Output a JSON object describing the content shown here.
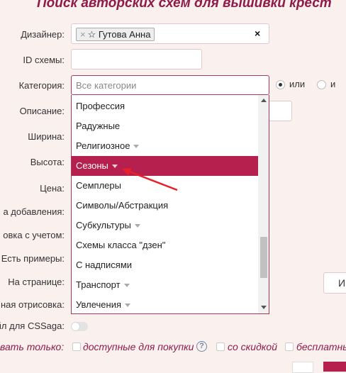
{
  "page_title": "Поиск авторских схем для вышивки крест",
  "labels": {
    "designer": "Дизайнер:",
    "scheme_id": "ID схемы:",
    "category": "Категория:",
    "description": "Описание:",
    "width": "Ширина:",
    "height": "Высота:",
    "price": "Цена:",
    "date_added": "а добавления:",
    "sort": "овка с учетом:",
    "examples": "Есть примеры:",
    "per_page": "На странице:",
    "drawing": "ная отрисовка:",
    "cssaga": "йл для CSSaga:",
    "show_only": "вать только:"
  },
  "designer_tag": "☆ Гутова Анна",
  "tag_remove": "×",
  "clear_icon": "×",
  "category_placeholder": "Все категории",
  "radio_or": "или",
  "radio_and": "и",
  "dropdown_options": [
    {
      "label": "Профессия",
      "caret": false
    },
    {
      "label": "Радужные",
      "caret": false
    },
    {
      "label": "Религиозное",
      "caret": true
    },
    {
      "label": "Сезоны",
      "caret": true,
      "highlighted": true
    },
    {
      "label": "Семплеры",
      "caret": false
    },
    {
      "label": "Символы/Абстракция",
      "caret": false
    },
    {
      "label": "Субкультуры",
      "caret": true
    },
    {
      "label": "Схемы класса \"дзен\"",
      "caret": false
    },
    {
      "label": "С надписями",
      "caret": false
    },
    {
      "label": "Транспорт",
      "caret": true
    },
    {
      "label": "Увлечения",
      "caret": true
    }
  ],
  "filters": {
    "available": "доступные для покупки",
    "help": "?",
    "discount": "со скидкой",
    "free": "бесплатны"
  },
  "right_button": "И",
  "colors": {
    "accent": "#b5204f",
    "title": "#8e1b48",
    "background": "#faf1ef"
  }
}
